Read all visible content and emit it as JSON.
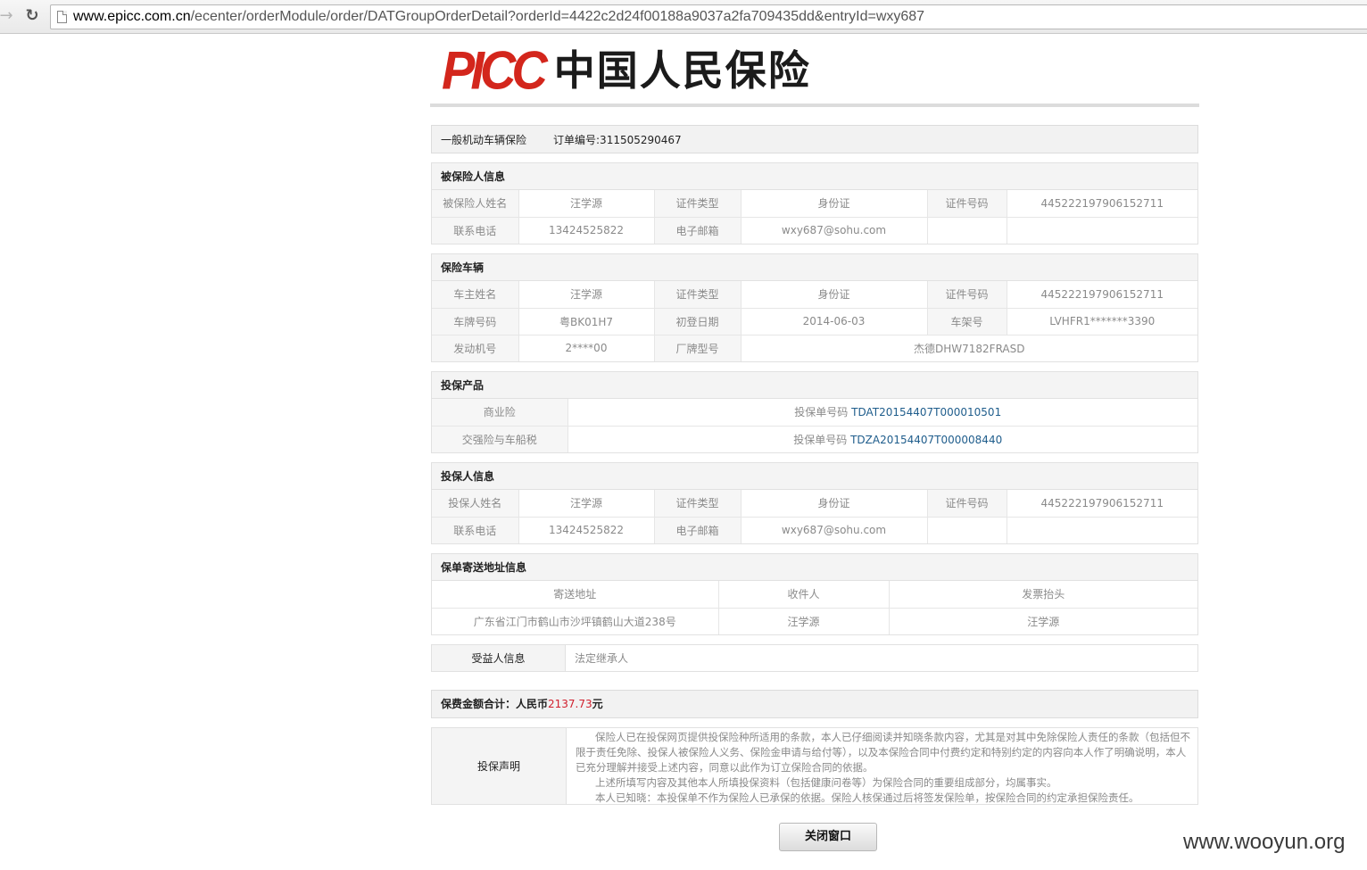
{
  "browser": {
    "url_host": "www.epicc.com.cn",
    "url_path": "/ecenter/orderModule/order/DATGroupOrderDetail?orderId=4422c2d24f00188a9037a2fa709435dd&entryId=wxy687"
  },
  "logo": {
    "brand": "PICC",
    "name": "中国人民保险"
  },
  "order": {
    "category": "一般机动车辆保险",
    "order_no": "订单编号:311505290467"
  },
  "insured": {
    "title": "被保险人信息",
    "rows": [
      [
        "被保险人姓名",
        "汪学源",
        "证件类型",
        "身份证",
        "证件号码",
        "445222197906152711"
      ],
      [
        "联系电话",
        "13424525822",
        "电子邮箱",
        "wxy687@sohu.com",
        "",
        ""
      ]
    ]
  },
  "vehicle": {
    "title": "保险车辆",
    "rows": [
      [
        "车主姓名",
        "汪学源",
        "证件类型",
        "身份证",
        "证件号码",
        "445222197906152711"
      ],
      [
        "车牌号码",
        "粤BK01H7",
        "初登日期",
        "2014-06-03",
        "车架号",
        "LVHFR1*******3390"
      ]
    ],
    "engine_label": "发动机号",
    "engine": "2****00",
    "model_label": "厂牌型号",
    "model": "杰德DHW7182FRASD"
  },
  "products": {
    "title": "投保产品",
    "items": [
      {
        "name": "商业险",
        "prefix": "投保单号码 ",
        "number": "TDAT20154407T000010501"
      },
      {
        "name": "交强险与车船税",
        "prefix": "投保单号码 ",
        "number": "TDZA20154407T000008440"
      }
    ]
  },
  "applicant": {
    "title": "投保人信息",
    "rows": [
      [
        "投保人姓名",
        "汪学源",
        "证件类型",
        "身份证",
        "证件号码",
        "445222197906152711"
      ],
      [
        "联系电话",
        "13424525822",
        "电子邮箱",
        "wxy687@sohu.com",
        "",
        ""
      ]
    ]
  },
  "delivery": {
    "title": "保单寄送地址信息",
    "headers": [
      "寄送地址",
      "收件人",
      "发票抬头"
    ],
    "values": [
      "广东省江门市鹤山市沙坪镇鹤山大道238号",
      "汪学源",
      "汪学源"
    ]
  },
  "beneficiary": {
    "label": "受益人信息",
    "value": "法定继承人"
  },
  "premium": {
    "label": "保费金额合计：人民币",
    "amount": "2137.73",
    "unit": "元"
  },
  "declaration": {
    "label": "投保声明",
    "paragraphs": [
      "保险人已在投保网页提供投保险种所适用的条款，本人已仔细阅读并知晓条款内容，尤其是对其中免除保险人责任的条款（包括但不限于责任免除、投保人被保险人义务、保险金申请与给付等），以及本保险合同中付费约定和特别约定的内容向本人作了明确说明，本人已充分理解并接受上述内容，同意以此作为订立保险合同的依据。",
      "上述所填写内容及其他本人所填投保资料（包括健康问卷等）为保险合同的重要组成部分，均属事实。",
      "本人已知晓：本投保单不作为保险人已承保的依据。保险人核保通过后将签发保险单，按保险合同的约定承担保险责任。"
    ]
  },
  "close_button": "关闭窗口",
  "watermark": "www.wooyun.org"
}
